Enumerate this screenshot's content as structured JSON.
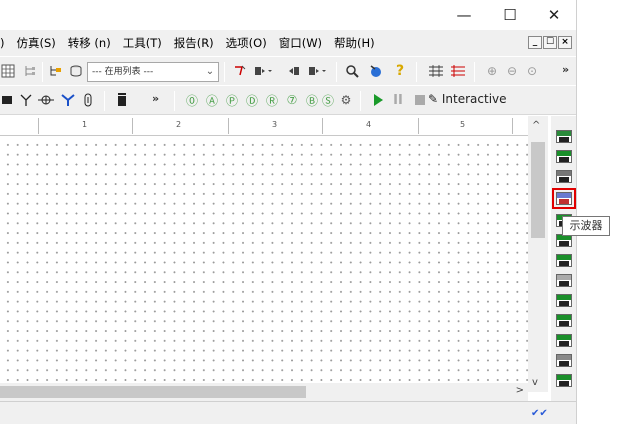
{
  "window": {
    "minimize_glyph": "—",
    "maximize_glyph": "☐",
    "close_glyph": "✕"
  },
  "menu": {
    "items": [
      ")",
      "仿真(S)",
      "转移 (n)",
      "工具(T)",
      "报告(R)",
      "选项(O)",
      "窗口(W)",
      "帮助(H)"
    ],
    "mdi_controls": [
      "_",
      "☐",
      "×"
    ]
  },
  "toolbar1": {
    "component_list_value": "--- 在用列表 ---",
    "overflow": "»"
  },
  "toolbar2": {
    "overflow": "»",
    "interactive_label": "Interactive"
  },
  "ruler": {
    "labels": [
      "1",
      "2",
      "3",
      "4",
      "5"
    ]
  },
  "instruments": {
    "tooltip": "示波器",
    "highlighted": "oscilloscope"
  },
  "scrollbars": {
    "up": "^",
    "down": "v",
    "right": ">"
  }
}
